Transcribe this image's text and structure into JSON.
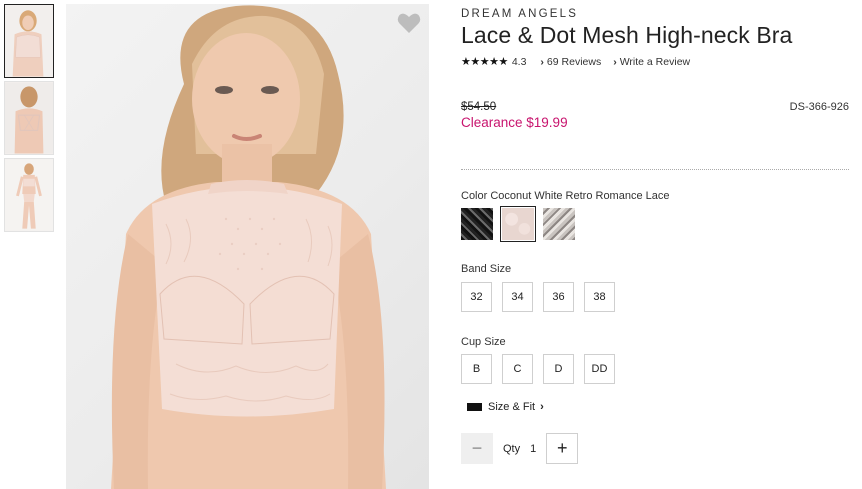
{
  "thumbnails": [
    {
      "name": "front view",
      "active": true
    },
    {
      "name": "back view",
      "active": false
    },
    {
      "name": "full body view",
      "active": false
    }
  ],
  "product": {
    "brand": "DREAM ANGELS",
    "title": "Lace & Dot Mesh High-neck Bra",
    "rating": {
      "stars_display": "★★★★★",
      "value": "4.3",
      "reviews_label": "69 Reviews",
      "write_review_label": "Write a Review"
    },
    "price": {
      "original": "$54.50",
      "clearance": "Clearance $19.99"
    },
    "sku": "DS-366-926"
  },
  "color": {
    "label": "Color Coconut White Retro Romance Lace",
    "swatches": [
      {
        "name": "black lace",
        "selected": false
      },
      {
        "name": "coconut white",
        "selected": true
      },
      {
        "name": "retro romance lace",
        "selected": false
      }
    ]
  },
  "band_size": {
    "label": "Band Size",
    "options": [
      "32",
      "34",
      "36",
      "38"
    ]
  },
  "cup_size": {
    "label": "Cup Size",
    "options": [
      "B",
      "C",
      "D",
      "DD"
    ]
  },
  "size_fit": {
    "label": "Size & Fit",
    "icon": "ruler-icon"
  },
  "quantity": {
    "minus": "−",
    "label": "Qty",
    "value": "1",
    "plus": "+"
  },
  "colors": {
    "clearance": "#c8146e",
    "border": "#cfcfcf"
  }
}
